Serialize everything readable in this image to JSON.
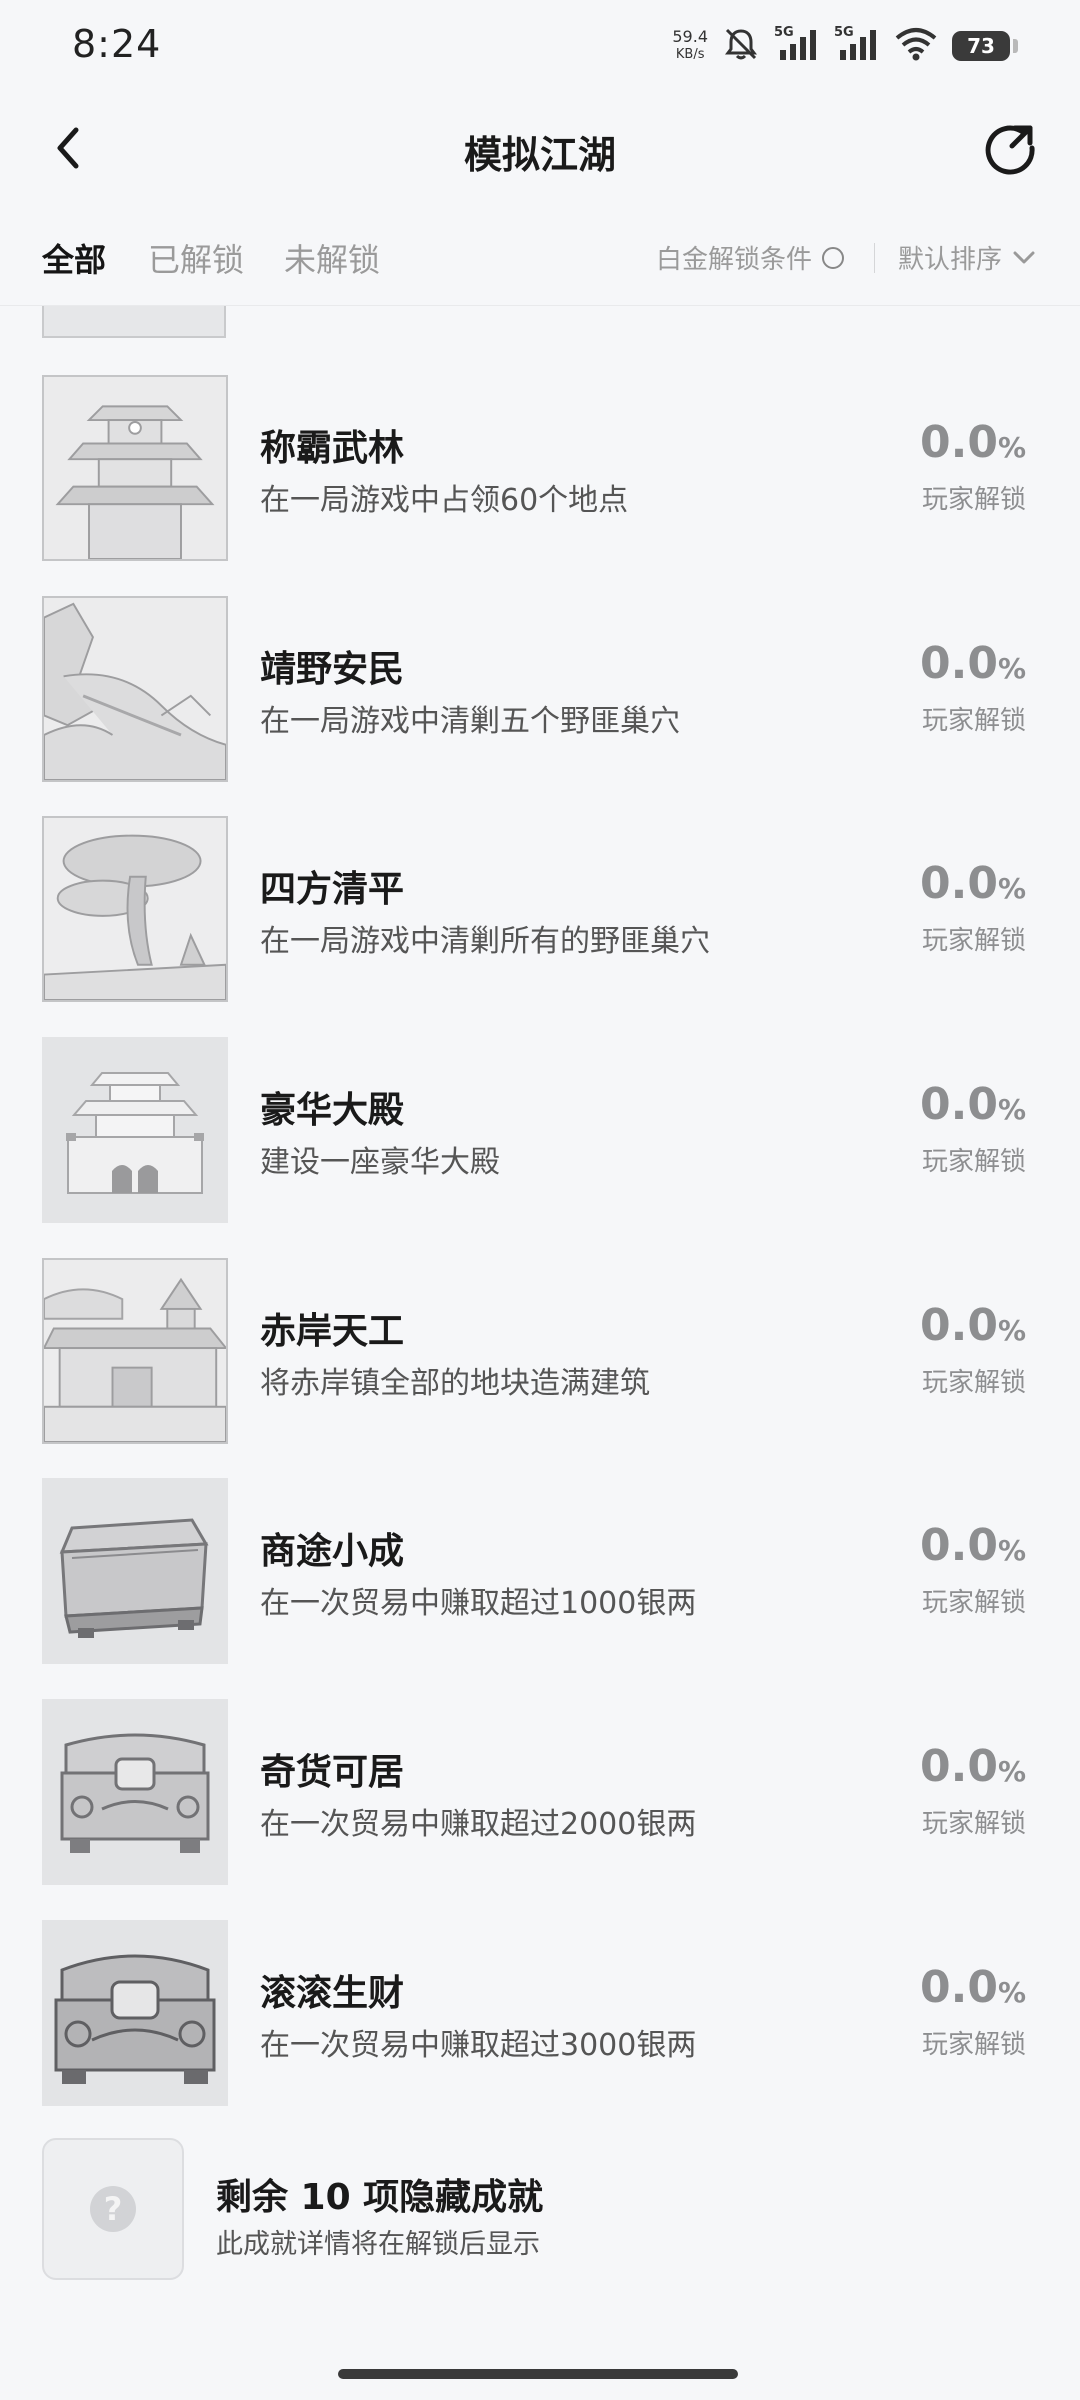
{
  "status_bar": {
    "time": "8:24",
    "net_speed": "59.4",
    "net_unit": "KB/s",
    "sig1": "5G",
    "sig2": "5G",
    "battery": "73",
    "icons": [
      "mute-bell-icon",
      "signal-icon",
      "signal-icon",
      "wifi-icon",
      "battery-icon"
    ]
  },
  "header": {
    "title": "模拟江湖",
    "back_icon": "chevron-left-icon",
    "share_icon": "refresh-share-icon"
  },
  "tabs": {
    "all": "全部",
    "unlocked": "已解锁",
    "locked": "未解锁",
    "active": "all"
  },
  "filters": {
    "platinum": "白金解锁条件",
    "sort": "默认排序"
  },
  "achievements": [
    {
      "title": "称霸武林",
      "desc": "在一局游戏中占领60个地点",
      "percent": "0.0",
      "unit": "%",
      "label": "玩家解锁",
      "icon": "palace-tower-icon"
    },
    {
      "title": "靖野安民",
      "desc": "在一局游戏中清剿五个野匪巢穴",
      "percent": "0.0",
      "unit": "%",
      "label": "玩家解锁",
      "icon": "mountain-river-icon"
    },
    {
      "title": "四方清平",
      "desc": "在一局游戏中清剿所有的野匪巢穴",
      "percent": "0.0",
      "unit": "%",
      "label": "玩家解锁",
      "icon": "pine-tree-icon"
    },
    {
      "title": "豪华大殿",
      "desc": "建设一座豪华大殿",
      "percent": "0.0",
      "unit": "%",
      "label": "玩家解锁",
      "icon": "grand-hall-icon"
    },
    {
      "title": "赤岸天工",
      "desc": "将赤岸镇全部的地块造满建筑",
      "percent": "0.0",
      "unit": "%",
      "label": "玩家解锁",
      "icon": "town-buildings-icon"
    },
    {
      "title": "商途小成",
      "desc": "在一次贸易中赚取超过1000银两",
      "percent": "0.0",
      "unit": "%",
      "label": "玩家解锁",
      "icon": "wooden-chest-icon"
    },
    {
      "title": "奇货可居",
      "desc": "在一次贸易中赚取超过2000银两",
      "percent": "0.0",
      "unit": "%",
      "label": "玩家解锁",
      "icon": "ornate-chest-icon"
    },
    {
      "title": "滚滚生财",
      "desc": "在一次贸易中赚取超过3000银两",
      "percent": "0.0",
      "unit": "%",
      "label": "玩家解锁",
      "icon": "treasure-chest-icon"
    }
  ],
  "hidden": {
    "title": "剩余 10 项隐藏成就",
    "desc": "此成就详情将在解锁后显示",
    "icon": "question-icon",
    "symbol": "?"
  }
}
